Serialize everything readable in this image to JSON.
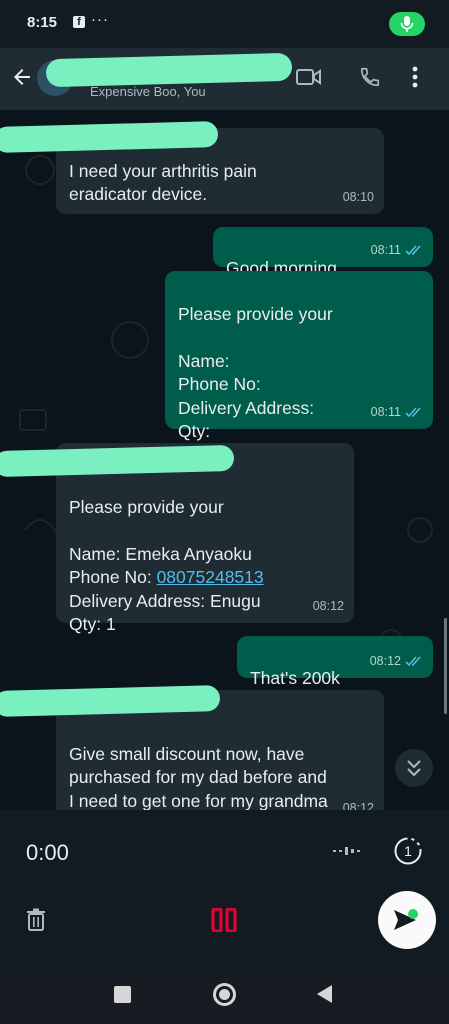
{
  "status_bar": {
    "time": "8:15",
    "app_icon": "facebook-icon",
    "more": "···",
    "mic_indicator_color": "#25d366"
  },
  "header": {
    "subtitle": "Expensive Boo, You",
    "icons": [
      "back-arrow-icon",
      "avatar",
      "video-call-icon",
      "voice-call-icon",
      "overflow-menu-icon"
    ]
  },
  "messages": [
    {
      "direction": "incoming",
      "text": "I need your arthritis pain\neradicator device.",
      "time": "08:10"
    },
    {
      "direction": "outgoing",
      "text": "Good morning",
      "time": "08:11",
      "status": "read"
    },
    {
      "direction": "outgoing",
      "text": "Please provide your\n\nName:\nPhone No:\nDelivery Address:\nQty:",
      "time": "08:11",
      "status": "read"
    },
    {
      "direction": "incoming",
      "text_before_link": "Please provide your\n\nName: Emeka Anyaoku\nPhone No: ",
      "link": "08075248513",
      "text_after_link": "\nDelivery Address: Enugu\nQty: 1",
      "time": "08:12"
    },
    {
      "direction": "outgoing",
      "text": "That's 200k",
      "time": "08:12",
      "status": "read"
    },
    {
      "direction": "incoming",
      "text": "Give small discount now, have\npurchased for my dad before and\nI need to get one for my grandma",
      "time": "08:12"
    }
  ],
  "recorder": {
    "elapsed": "0:00",
    "view_once_label": "1"
  },
  "colors": {
    "incoming_bubble": "#1f2c34",
    "outgoing_bubble": "#005c4b",
    "read_tick": "#53bdeb",
    "pause": "#ea0038"
  }
}
